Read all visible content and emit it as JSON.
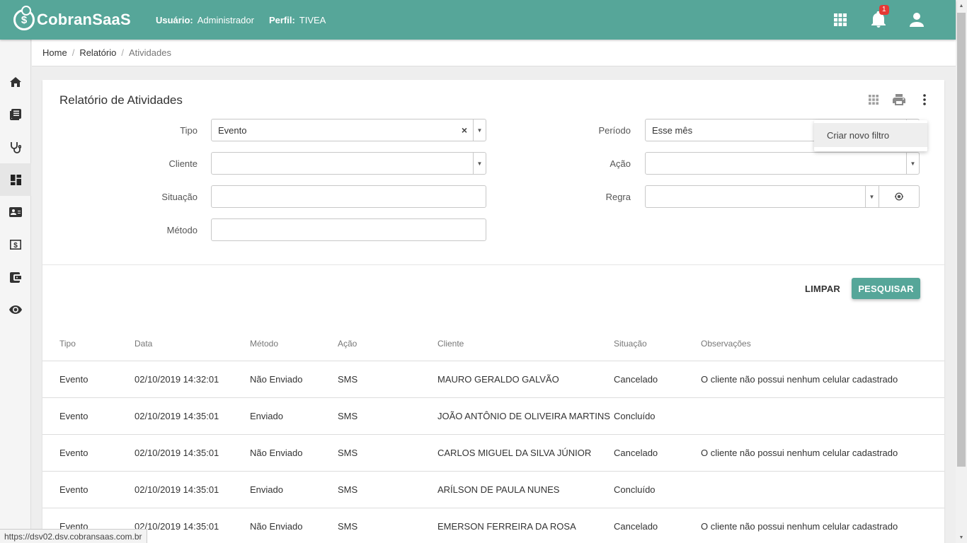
{
  "header": {
    "logo_text": "CobranSaaS",
    "logo_symbol": "$",
    "user_label": "Usuário:",
    "user_value": "Administrador",
    "profile_label": "Perfil:",
    "profile_value": "TIVEA",
    "notification_count": "1",
    "bg_color": "#56a699"
  },
  "sidebar": {
    "items": [
      {
        "icon": "home-icon"
      },
      {
        "icon": "library-books-icon"
      },
      {
        "icon": "stethoscope-icon"
      },
      {
        "icon": "dashboard-icon",
        "active": true
      },
      {
        "icon": "contact-card-icon"
      },
      {
        "icon": "money-icon"
      },
      {
        "icon": "wallet-icon"
      },
      {
        "icon": "eye-icon"
      }
    ]
  },
  "breadcrumb": {
    "home": "Home",
    "relatorio": "Relatório",
    "current": "Atividades"
  },
  "page": {
    "title": "Relatório de Atividades"
  },
  "filters": {
    "tipo_label": "Tipo",
    "tipo_value": "Evento",
    "cliente_label": "Cliente",
    "cliente_value": "",
    "situacao_label": "Situação",
    "situacao_value": "",
    "metodo_label": "Método",
    "metodo_value": "",
    "periodo_label": "Período",
    "periodo_value": "Esse mês",
    "acao_label": "Ação",
    "acao_value": "",
    "regra_label": "Regra",
    "regra_value": ""
  },
  "menu": {
    "criar_filtro": "Criar novo filtro"
  },
  "buttons": {
    "limpar": "LIMPAR",
    "pesquisar": "PESQUISAR"
  },
  "table": {
    "headers": [
      "Tipo",
      "Data",
      "Método",
      "Ação",
      "Cliente",
      "Situação",
      "Observações"
    ],
    "rows": [
      [
        "Evento",
        "02/10/2019 14:32:01",
        "Não Enviado",
        "SMS",
        "MAURO GERALDO GALVÃO",
        "Cancelado",
        "O cliente não possui nenhum celular cadastrado"
      ],
      [
        "Evento",
        "02/10/2019 14:35:01",
        "Enviado",
        "SMS",
        "JOÃO ANTÔNIO DE OLIVEIRA MARTINS",
        "Concluído",
        ""
      ],
      [
        "Evento",
        "02/10/2019 14:35:01",
        "Não Enviado",
        "SMS",
        "CARLOS MIGUEL DA SILVA JÚNIOR",
        "Cancelado",
        "O cliente não possui nenhum celular cadastrado"
      ],
      [
        "Evento",
        "02/10/2019 14:35:01",
        "Enviado",
        "SMS",
        "ARÍLSON DE PAULA NUNES",
        "Concluído",
        ""
      ],
      [
        "Evento",
        "02/10/2019 14:35:01",
        "Não Enviado",
        "SMS",
        "EMERSON FERREIRA DA ROSA",
        "Cancelado",
        "O cliente não possui nenhum celular cadastrado"
      ]
    ]
  },
  "status_bar": {
    "url": "https://dsv02.dsv.cobransaas.com.br"
  }
}
